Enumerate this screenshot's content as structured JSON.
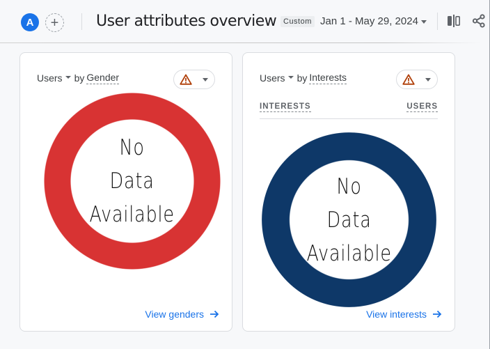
{
  "header": {
    "avatar_letter": "A",
    "add_comparison": "+",
    "title": "User attributes overview",
    "date_chip": "Custom",
    "date_range": "Jan 1 - May 29, 2024",
    "icons": [
      "compare-icon",
      "share-icon"
    ]
  },
  "cards": [
    {
      "metric": "Users",
      "by": "by",
      "dimension": "Gender",
      "status_icon": "warning-icon",
      "placeholder_text": [
        "No",
        "Data",
        "Available"
      ],
      "ring_color": "#d83333",
      "link": "View genders"
    },
    {
      "metric": "Users",
      "by": "by",
      "dimension": "Interests",
      "status_icon": "warning-icon",
      "columns": [
        "INTERESTS",
        "USERS"
      ],
      "placeholder_text": [
        "No",
        "Data",
        "Available"
      ],
      "ring_color": "#0e3868",
      "link": "View interests"
    }
  ],
  "colors": {
    "accent": "#1a73e8",
    "warning": "#b0400a",
    "background": "#f7f8fa"
  }
}
